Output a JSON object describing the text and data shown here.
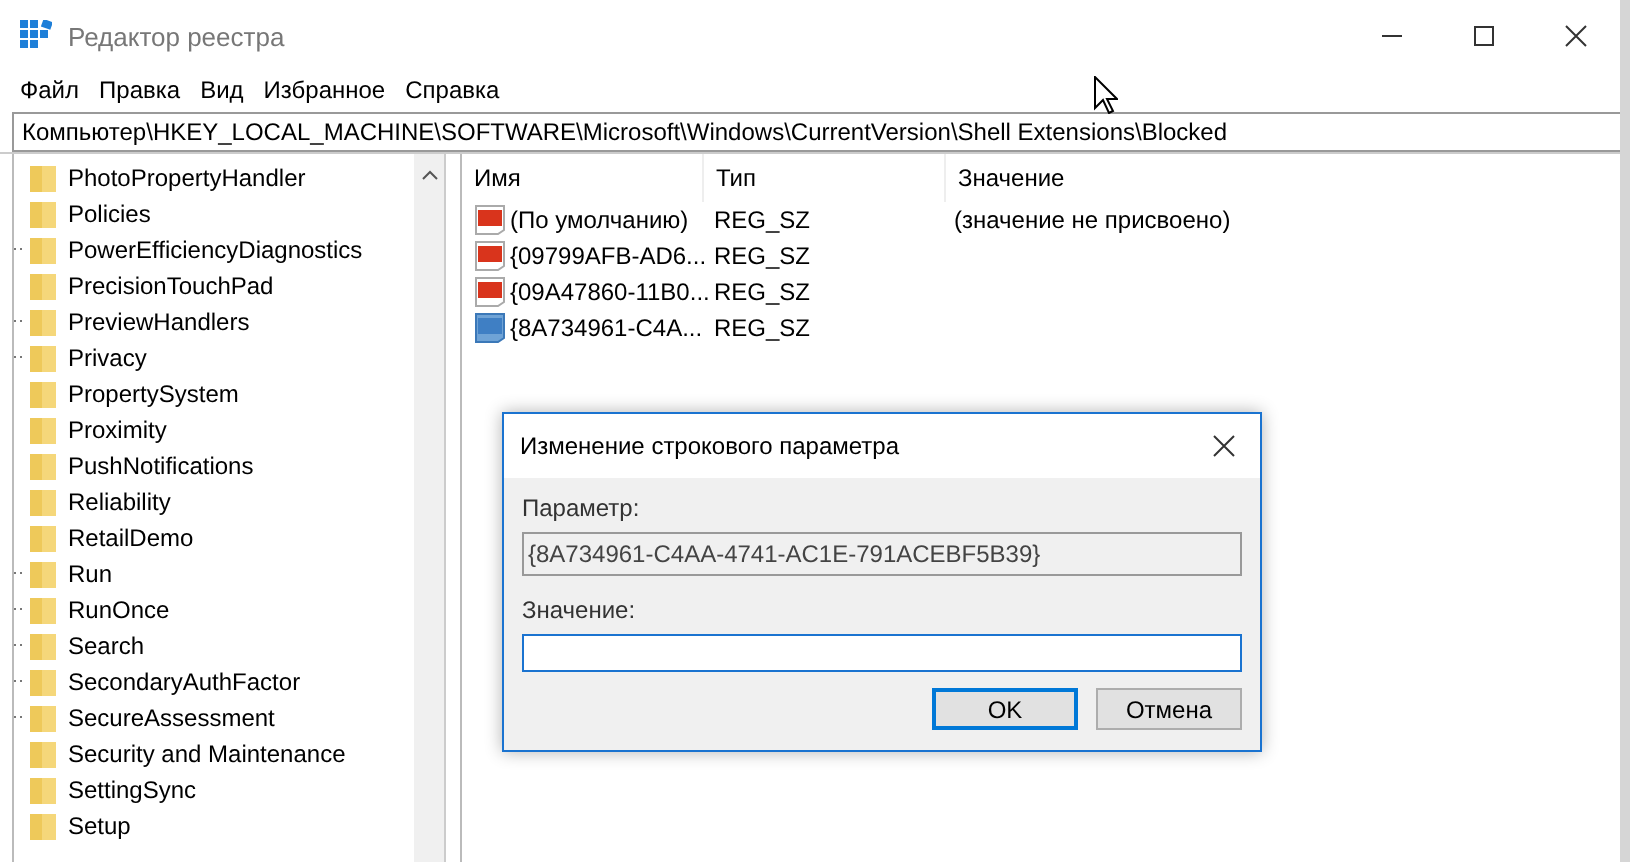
{
  "window": {
    "title": "Редактор реестра"
  },
  "menu": [
    "Файл",
    "Правка",
    "Вид",
    "Избранное",
    "Справка"
  ],
  "address": "Компьютер\\HKEY_LOCAL_MACHINE\\SOFTWARE\\Microsoft\\Windows\\CurrentVersion\\Shell Extensions\\Blocked",
  "tree": [
    {
      "label": "PhotoPropertyHandler",
      "expandable": false
    },
    {
      "label": "Policies",
      "expandable": false
    },
    {
      "label": "PowerEfficiencyDiagnostics",
      "expandable": true
    },
    {
      "label": "PrecisionTouchPad",
      "expandable": false
    },
    {
      "label": "PreviewHandlers",
      "expandable": true
    },
    {
      "label": "Privacy",
      "expandable": true
    },
    {
      "label": "PropertySystem",
      "expandable": false
    },
    {
      "label": "Proximity",
      "expandable": false
    },
    {
      "label": "PushNotifications",
      "expandable": false
    },
    {
      "label": "Reliability",
      "expandable": false
    },
    {
      "label": "RetailDemo",
      "expandable": false
    },
    {
      "label": "Run",
      "expandable": true
    },
    {
      "label": "RunOnce",
      "expandable": true
    },
    {
      "label": "Search",
      "expandable": true
    },
    {
      "label": "SecondaryAuthFactor",
      "expandable": true
    },
    {
      "label": "SecureAssessment",
      "expandable": true
    },
    {
      "label": "Security and Maintenance",
      "expandable": false
    },
    {
      "label": "SettingSync",
      "expandable": false
    },
    {
      "label": "Setup",
      "expandable": false
    }
  ],
  "table": {
    "columns": [
      "Имя",
      "Тип",
      "Значение"
    ],
    "rows": [
      {
        "name": "(По умолчанию)",
        "type": "REG_SZ",
        "value": "(значение не присвоено)",
        "selected": false
      },
      {
        "name": "{09799AFB-AD6...",
        "type": "REG_SZ",
        "selected": false
      },
      {
        "name": "{09A47860-11B0...",
        "type": "REG_SZ",
        "selected": false
      },
      {
        "name": "{8A734961-C4A...",
        "type": "REG_SZ",
        "selected": true
      }
    ]
  },
  "dialog": {
    "title": "Изменение строкового параметра",
    "param_label": "Параметр:",
    "param_value": "{8A734961-C4AA-4741-AC1E-791ACEBF5B39}",
    "value_label": "Значение:",
    "buttons": [
      {
        "label": "OK",
        "default": true
      },
      {
        "label": "Отмена",
        "default": false
      }
    ]
  }
}
